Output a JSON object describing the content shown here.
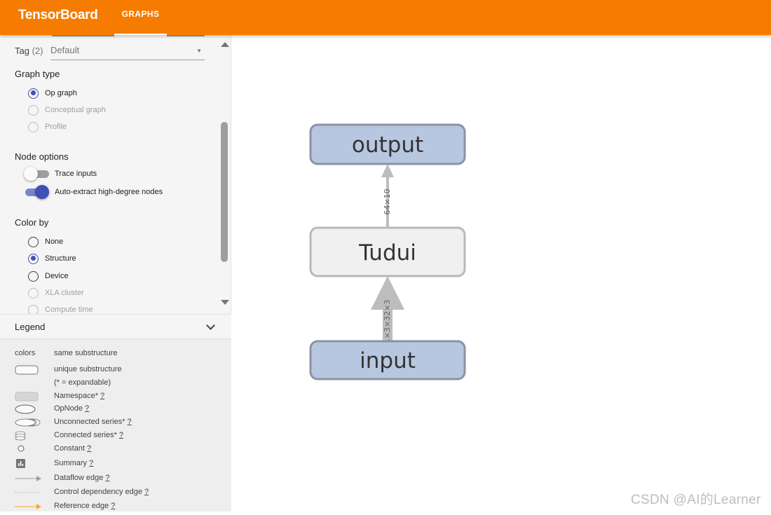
{
  "app": {
    "title": "TensorBoard",
    "tabs": [
      {
        "label": "GRAPHS",
        "active": true
      }
    ]
  },
  "colors": {
    "header": "#f57c00",
    "accent": "#3f51b5",
    "node_fill_struct": "#b8c7e0",
    "node_fill_unique": "#f0f0f0",
    "edge": "#bdbdbd",
    "reference_edge": "#ffa726"
  },
  "controls": {
    "tag": {
      "label": "Tag",
      "count": "(2)",
      "value": "Default"
    },
    "graph_type": {
      "title": "Graph type",
      "options": [
        {
          "label": "Op graph",
          "selected": true,
          "enabled": true
        },
        {
          "label": "Conceptual graph",
          "selected": false,
          "enabled": false
        },
        {
          "label": "Profile",
          "selected": false,
          "enabled": false
        }
      ]
    },
    "node_options": {
      "title": "Node options",
      "toggles": [
        {
          "label": "Trace inputs",
          "on": false
        },
        {
          "label": "Auto-extract high-degree nodes",
          "on": true
        }
      ]
    },
    "color_by": {
      "title": "Color by",
      "options": [
        {
          "label": "None",
          "selected": false,
          "enabled": true
        },
        {
          "label": "Structure",
          "selected": true,
          "enabled": true
        },
        {
          "label": "Device",
          "selected": false,
          "enabled": true
        },
        {
          "label": "XLA cluster",
          "selected": false,
          "enabled": false
        },
        {
          "label": "Compute time",
          "selected": false,
          "enabled": false
        }
      ]
    }
  },
  "legend": {
    "title": "Legend",
    "items": [
      {
        "symbol": "colors",
        "label": "same substructure",
        "help": ""
      },
      {
        "symbol": "unique-rect",
        "label": "unique substructure",
        "help": ""
      },
      {
        "symbol": "",
        "label": "(* = expandable)",
        "help": ""
      },
      {
        "symbol": "namespace-rect",
        "label": "Namespace*",
        "help": "?"
      },
      {
        "symbol": "opnode-ellipse",
        "label": "OpNode",
        "help": "?"
      },
      {
        "symbol": "unconnected-series",
        "label": "Unconnected series*",
        "help": "?"
      },
      {
        "symbol": "connected-series",
        "label": "Connected series*",
        "help": "?"
      },
      {
        "symbol": "constant-circle",
        "label": "Constant",
        "help": "?"
      },
      {
        "symbol": "summary-icon",
        "label": "Summary",
        "help": "?"
      },
      {
        "symbol": "dataflow-edge",
        "label": "Dataflow edge",
        "help": "?"
      },
      {
        "symbol": "control-edge",
        "label": "Control dependency edge",
        "help": "?"
      },
      {
        "symbol": "reference-edge",
        "label": "Reference edge",
        "help": "?"
      }
    ]
  },
  "graph": {
    "nodes": [
      {
        "id": "output",
        "label": "output",
        "style": "structure"
      },
      {
        "id": "tudui",
        "label": "Tudui",
        "style": "unique"
      },
      {
        "id": "input",
        "label": "input",
        "style": "structure"
      }
    ],
    "edges": [
      {
        "from": "input",
        "to": "tudui",
        "shape": "1×3×32×3"
      },
      {
        "from": "tudui",
        "to": "output",
        "shape": "64×10"
      }
    ]
  },
  "watermark": "CSDN @AI的Learner"
}
